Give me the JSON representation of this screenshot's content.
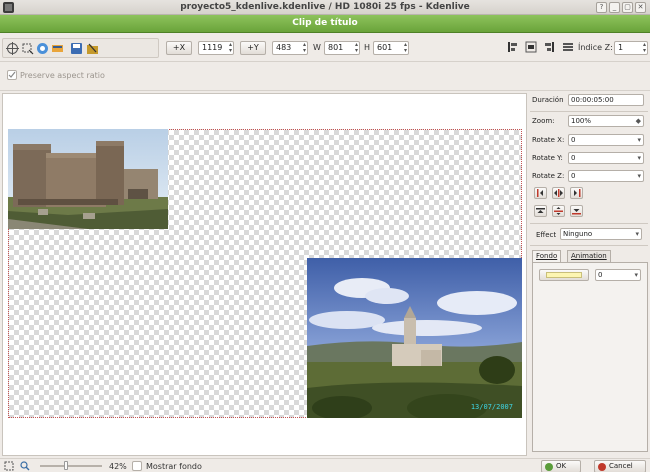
{
  "window": {
    "title": "proyecto5_kdenlive.kdenlive / HD 1080i 25 fps - Kdenlive",
    "icon": "kdenlive-icon",
    "controls": [
      "?",
      "_",
      "▢",
      "✕"
    ]
  },
  "dialog": {
    "title": "Clip de título"
  },
  "toolbar": {
    "tools": [
      "select-tool-icon",
      "rectangle-tool-icon",
      "text-tool-icon",
      "image-tool-icon",
      "save-icon",
      "open-icon"
    ],
    "x_button": "+X",
    "x_value": "1119",
    "y_button": "+Y",
    "y_value": "483",
    "w_label": "W",
    "w_value": "801",
    "h_label": "H",
    "h_value": "601",
    "z_index_label": "Índice Z:",
    "z_index_value": "1",
    "align_icons": [
      "align-left-icon",
      "align-center-icon",
      "align-right-icon",
      "align-justify-icon"
    ]
  },
  "options": {
    "preserve_label": "Preserve aspect ratio",
    "preserve_checked": true
  },
  "canvas": {
    "photo2_date": "13/07/2007"
  },
  "panel": {
    "duration_label": "Duración",
    "duration_value": "00:00:05:00",
    "zoom_label": "Zoom:",
    "zoom_value": "100%",
    "rotate_x_label": "Rotate X:",
    "rotate_x_value": "0",
    "rotate_y_label": "Rotate Y:",
    "rotate_y_value": "0",
    "rotate_z_label": "Rotate Z:",
    "rotate_z_value": "0",
    "effect_label": "Effect",
    "effect_value": "Ninguno",
    "tab_fondo": "Fondo",
    "tab_animation": "Animation",
    "bg_color": "#fdf6b2",
    "bg_value": "0"
  },
  "bottom": {
    "zoom_percent": "42%",
    "zoom_level": 0.42,
    "show_bg_label": "Mostrar fondo",
    "ok_label": "OK",
    "cancel_label": "Cancel"
  }
}
